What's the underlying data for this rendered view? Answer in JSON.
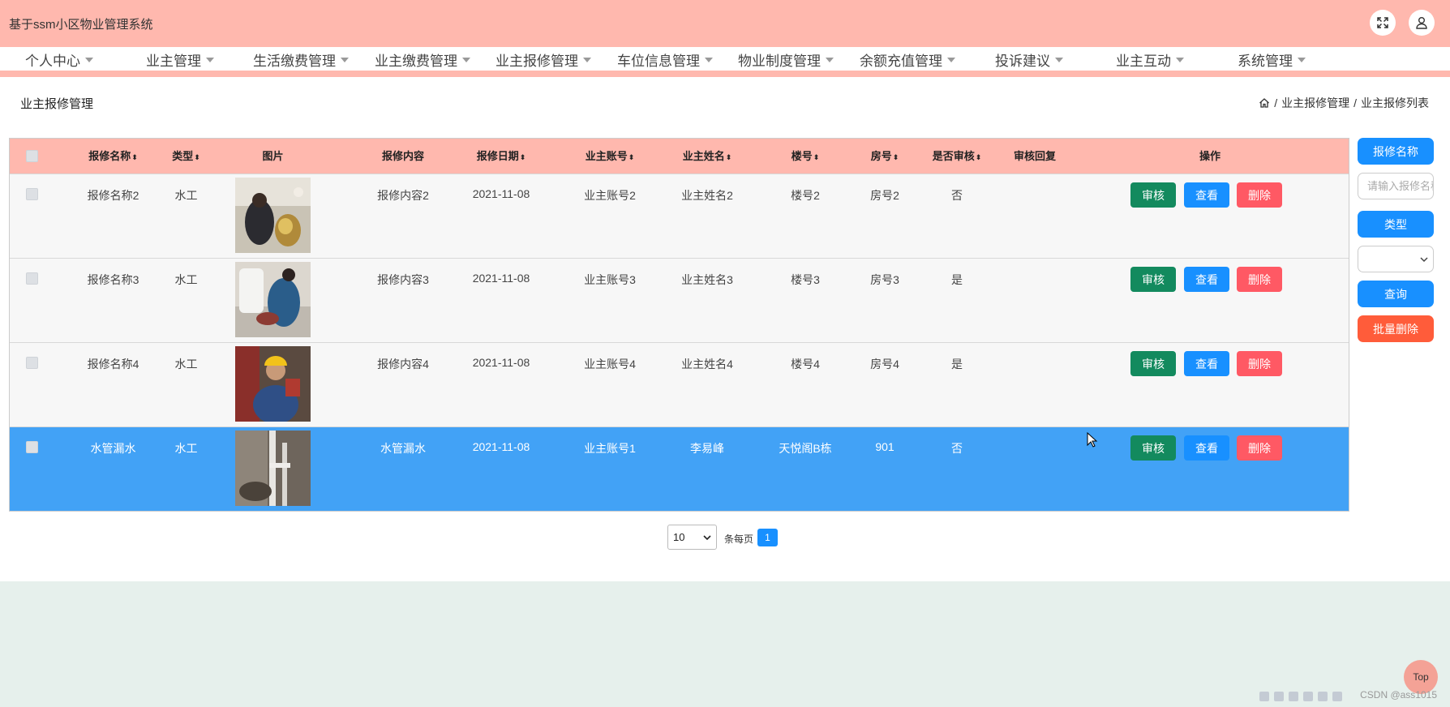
{
  "app": {
    "title": "基于ssm小区物业管理系统"
  },
  "nav": {
    "items": [
      "个人中心",
      "业主管理",
      "生活缴费管理",
      "业主缴费管理",
      "业主报修管理",
      "车位信息管理",
      "物业制度管理",
      "余额充值管理",
      "投诉建议",
      "业主互动",
      "系统管理"
    ]
  },
  "page": {
    "title": "业主报修管理"
  },
  "breadcrumb": {
    "section": "业主报修管理",
    "separator": "/",
    "current": "业主报修列表"
  },
  "table": {
    "headers": [
      "报修名称",
      "类型",
      "图片",
      "报修内容",
      "报修日期",
      "业主账号",
      "业主姓名",
      "楼号",
      "房号",
      "是否审核",
      "审核回复",
      "操作"
    ],
    "sort_glyph": "⬍",
    "rows": [
      {
        "name": "报修名称2",
        "type": "水工",
        "content": "报修内容2",
        "date": "2021-11-08",
        "account": "业主账号2",
        "owner": "业主姓名2",
        "building": "楼号2",
        "room": "房号2",
        "audited": "否",
        "reply": ""
      },
      {
        "name": "报修名称3",
        "type": "水工",
        "content": "报修内容3",
        "date": "2021-11-08",
        "account": "业主账号3",
        "owner": "业主姓名3",
        "building": "楼号3",
        "room": "房号3",
        "audited": "是",
        "reply": ""
      },
      {
        "name": "报修名称4",
        "type": "水工",
        "content": "报修内容4",
        "date": "2021-11-08",
        "account": "业主账号4",
        "owner": "业主姓名4",
        "building": "楼号4",
        "room": "房号4",
        "audited": "是",
        "reply": ""
      },
      {
        "name": "水管漏水",
        "type": "水工",
        "content": "水管漏水",
        "date": "2021-11-08",
        "account": "业主账号1",
        "owner": "李易峰",
        "building": "天悦阁B栋",
        "room": "901",
        "audited": "否",
        "reply": ""
      }
    ],
    "actions": {
      "audit": "审核",
      "view": "查看",
      "delete": "删除"
    }
  },
  "sidebar": {
    "name_label": "报修名称",
    "name_placeholder": "请输入报修名称",
    "type_label": "类型",
    "type_value": "",
    "query": "查询",
    "batch_delete": "批量删除"
  },
  "pagination": {
    "page_size": "10",
    "per_page_label": "条每页",
    "current_page": "1"
  },
  "misc": {
    "top": "Top",
    "watermark": "CSDN @ass1015"
  },
  "colors": {
    "header": "#ffb8ae",
    "selected_row": "#42a2f6",
    "primary": "#1890ff",
    "audit": "#138a5e",
    "danger": "#ff5964",
    "batch_delete": "#ff5c3a",
    "footer": "#e6f0ec"
  },
  "icons": [
    "fullscreen-icon",
    "user-icon",
    "home-icon",
    "select-arrow-icon"
  ]
}
